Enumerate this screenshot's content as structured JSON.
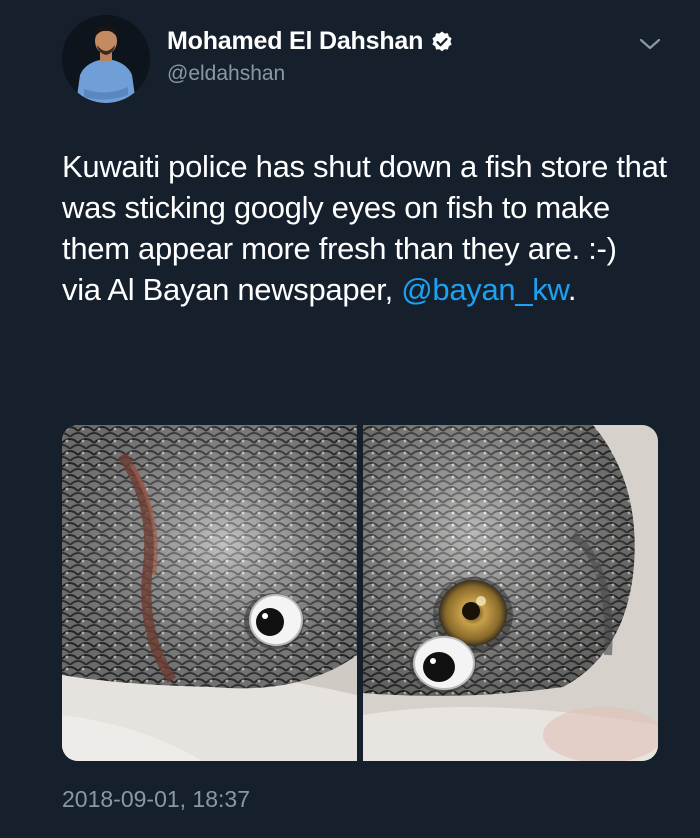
{
  "author": {
    "display_name": "Mohamed El Dahshan",
    "handle": "@eldahshan",
    "verified": true,
    "avatar_icon": "person-avatar"
  },
  "tweet": {
    "text": "Kuwaiti police has shut down a fish store that was sticking googly eyes on fish to make them appear more fresh than they are. :-)",
    "via_prefix": "via Al Bayan newspaper, ",
    "mention": "@bayan_kw",
    "via_suffix": ".",
    "timestamp": "2018-09-01, 18:37"
  },
  "icons": {
    "verified": "verified-badge-icon",
    "menu": "chevron-down-icon"
  },
  "colors": {
    "background": "#16202d",
    "link": "#1da1f2",
    "muted": "#8899a6"
  }
}
